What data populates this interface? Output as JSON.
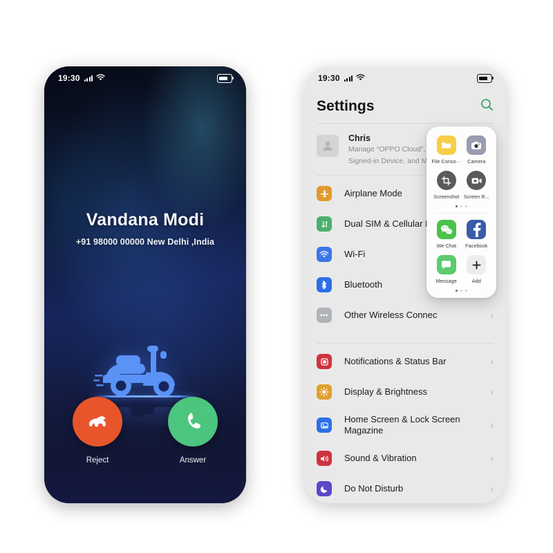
{
  "call_screen": {
    "status_bar": {
      "time": "19:30",
      "signal_icon": "signal-bars-icon",
      "wifi_icon": "wifi-icon",
      "battery_icon": "battery-icon"
    },
    "caller_name": "Vandana Modi",
    "caller_number": "+91 98000 00000 New Delhi ,India",
    "illustration": "scooter-illustration",
    "illustration_color": "#5a92f5",
    "reject": {
      "label": "Reject",
      "color": "#E8552B",
      "icon": "phone-hangup-icon"
    },
    "answer": {
      "label": "Answer",
      "color": "#4CC57F",
      "icon": "phone-answer-icon"
    }
  },
  "settings_screen": {
    "status_bar": {
      "time": "19:30",
      "signal_icon": "signal-bars-icon",
      "wifi_icon": "wifi-icon",
      "battery_icon": "battery-icon"
    },
    "title": "Settings",
    "search_icon": "search-icon",
    "search_icon_color": "#2BA05A",
    "account": {
      "avatar_icon": "person-avatar-icon",
      "name": "Chris",
      "line1": "Manage “OPPO Cloud”, “Fin",
      "line2": "Signed-in Device, and More"
    },
    "group1": [
      {
        "label": "Airplane Mode",
        "icon": "airplane-icon",
        "color": "#E09A2E"
      },
      {
        "label": "Dual SIM  & Cellular Ne",
        "icon": "sim-card-icon",
        "color": "#4CAF6B"
      },
      {
        "label": "Wi-Fi",
        "icon": "wifi-icon",
        "color": "#3B76E8"
      },
      {
        "label": "Bluetooth",
        "icon": "bluetooth-icon",
        "color": "#2E6FE8"
      },
      {
        "label": "Other Wireless Connec",
        "icon": "ellipsis-icon",
        "color": "#B0B3B8"
      }
    ],
    "group2": [
      {
        "label": "Notifications & Status Bar",
        "icon": "notifications-icon",
        "color": "#CC3440"
      },
      {
        "label": "Display & Brightness",
        "icon": "brightness-icon",
        "color": "#E0A02E"
      },
      {
        "label": "Home Screen & Lock Screen Magazine",
        "icon": "home-screen-icon",
        "color": "#2E6FE8"
      },
      {
        "label": "Sound & Vibration",
        "icon": "speaker-icon",
        "color": "#CC3440"
      },
      {
        "label": "Do Not Disturb",
        "icon": "moon-icon",
        "color": "#5B47C8"
      }
    ],
    "chevron": "›"
  },
  "float_panel": {
    "page1": [
      {
        "label": "File Conso···",
        "icon": "folder-icon",
        "color": "#F7CE46",
        "shape": "rounded"
      },
      {
        "label": "Camera",
        "icon": "camera-icon",
        "color": "#9A9DB0",
        "shape": "rounded"
      },
      {
        "label": "Screenshot",
        "icon": "screenshot-crop-icon",
        "color": "#5A5A5A",
        "shape": "circle"
      },
      {
        "label": "Screen R...",
        "icon": "screen-recorder-icon",
        "color": "#5A5A5A",
        "shape": "circle"
      }
    ],
    "page1_dots": {
      "count": 3,
      "active": 0
    },
    "page2": [
      {
        "label": "We Chat",
        "icon": "wechat-icon",
        "color": "#4CC14C",
        "shape": "rounded"
      },
      {
        "label": "Facebook",
        "icon": "facebook-icon",
        "color": "#3A5CA8",
        "shape": "rounded"
      },
      {
        "label": "Message",
        "icon": "message-bubble-icon",
        "color": "#5CCB6E",
        "shape": "rounded"
      },
      {
        "label": "Add",
        "icon": "plus-icon",
        "color": "#EDEDED",
        "shape": "rounded"
      }
    ],
    "page2_dots": {
      "count": 3,
      "active": 0
    }
  }
}
